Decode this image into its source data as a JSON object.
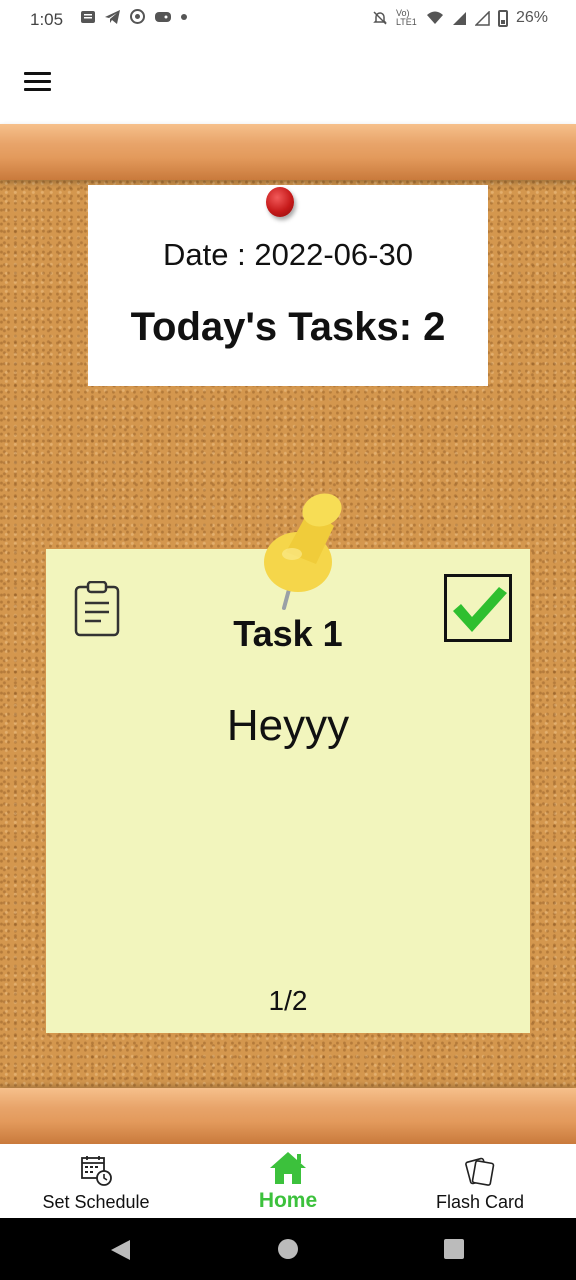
{
  "status_bar": {
    "time": "1:05",
    "signal_text": "Vo) LTE1",
    "battery": "26%"
  },
  "board": {
    "date_line": "Date : 2022-06-30",
    "tasks_line": "Today's Tasks: 2"
  },
  "task": {
    "title": "Task 1",
    "body": "Heyyy",
    "pager": "1/2",
    "completed": true
  },
  "bottom_nav": {
    "items": [
      {
        "label": "Set Schedule",
        "icon": "calendar-clock-icon"
      },
      {
        "label": "Home",
        "icon": "home-icon",
        "active": true
      },
      {
        "label": "Flash Card",
        "icon": "flash-card-icon"
      }
    ]
  },
  "colors": {
    "accent_green": "#3cc13c",
    "note_yellow": "#f2f5bd",
    "cork": "#d4974e"
  }
}
